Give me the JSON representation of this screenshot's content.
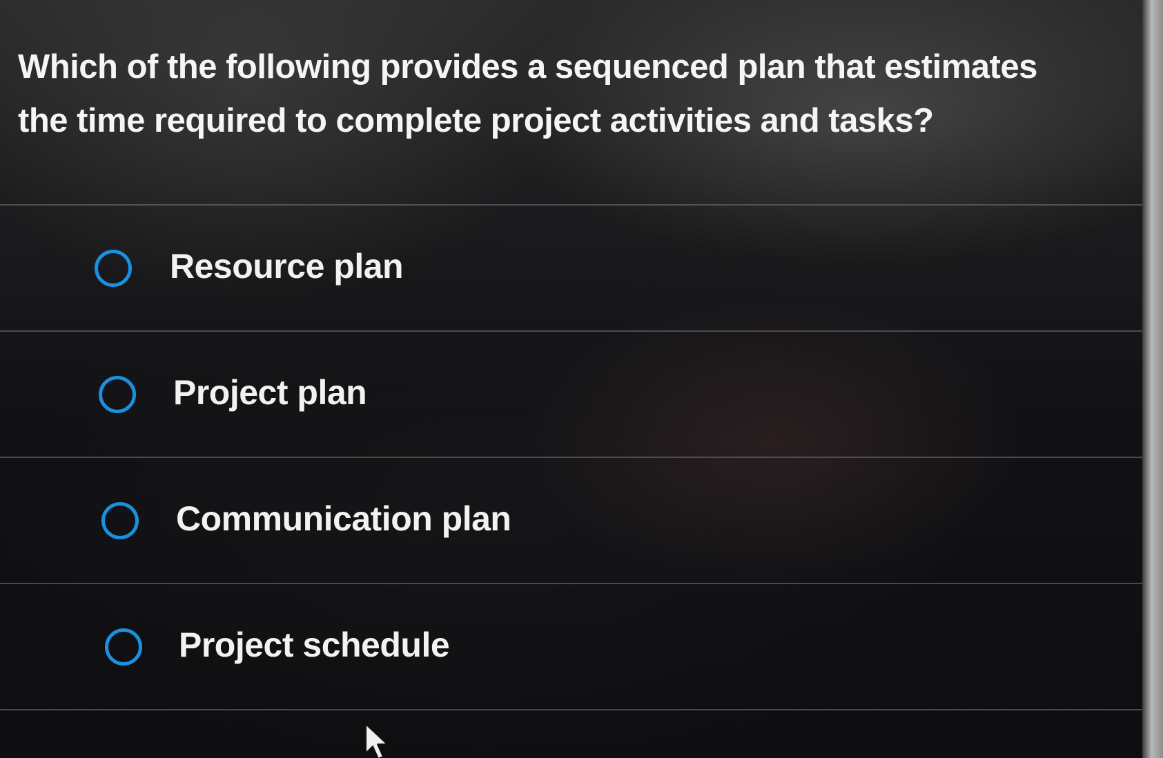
{
  "question": {
    "text": "Which of the following provides a sequenced plan that estimates the time required to complete project activities and tasks?"
  },
  "options": [
    {
      "label": "Resource plan",
      "selected": false
    },
    {
      "label": "Project plan",
      "selected": false
    },
    {
      "label": "Communication plan",
      "selected": false
    },
    {
      "label": "Project schedule",
      "selected": false
    }
  ],
  "colors": {
    "radio_accent": "#1b8fe0",
    "background": "#121214",
    "text": "#f4f4f4"
  },
  "icons": {
    "cursor": "mouse-pointer-arrow",
    "radio": "radio-unchecked"
  }
}
